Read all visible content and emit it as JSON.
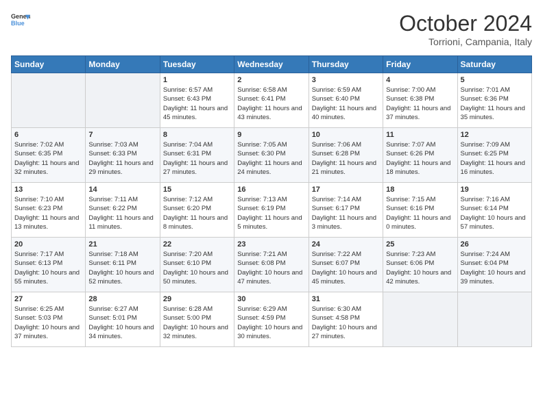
{
  "logo": {
    "line1": "General",
    "line2": "Blue"
  },
  "title": "October 2024",
  "location": "Torrioni, Campania, Italy",
  "days_of_week": [
    "Sunday",
    "Monday",
    "Tuesday",
    "Wednesday",
    "Thursday",
    "Friday",
    "Saturday"
  ],
  "weeks": [
    [
      {
        "num": "",
        "sunrise": "",
        "sunset": "",
        "daylight": ""
      },
      {
        "num": "",
        "sunrise": "",
        "sunset": "",
        "daylight": ""
      },
      {
        "num": "1",
        "sunrise": "Sunrise: 6:57 AM",
        "sunset": "Sunset: 6:43 PM",
        "daylight": "Daylight: 11 hours and 45 minutes."
      },
      {
        "num": "2",
        "sunrise": "Sunrise: 6:58 AM",
        "sunset": "Sunset: 6:41 PM",
        "daylight": "Daylight: 11 hours and 43 minutes."
      },
      {
        "num": "3",
        "sunrise": "Sunrise: 6:59 AM",
        "sunset": "Sunset: 6:40 PM",
        "daylight": "Daylight: 11 hours and 40 minutes."
      },
      {
        "num": "4",
        "sunrise": "Sunrise: 7:00 AM",
        "sunset": "Sunset: 6:38 PM",
        "daylight": "Daylight: 11 hours and 37 minutes."
      },
      {
        "num": "5",
        "sunrise": "Sunrise: 7:01 AM",
        "sunset": "Sunset: 6:36 PM",
        "daylight": "Daylight: 11 hours and 35 minutes."
      }
    ],
    [
      {
        "num": "6",
        "sunrise": "Sunrise: 7:02 AM",
        "sunset": "Sunset: 6:35 PM",
        "daylight": "Daylight: 11 hours and 32 minutes."
      },
      {
        "num": "7",
        "sunrise": "Sunrise: 7:03 AM",
        "sunset": "Sunset: 6:33 PM",
        "daylight": "Daylight: 11 hours and 29 minutes."
      },
      {
        "num": "8",
        "sunrise": "Sunrise: 7:04 AM",
        "sunset": "Sunset: 6:31 PM",
        "daylight": "Daylight: 11 hours and 27 minutes."
      },
      {
        "num": "9",
        "sunrise": "Sunrise: 7:05 AM",
        "sunset": "Sunset: 6:30 PM",
        "daylight": "Daylight: 11 hours and 24 minutes."
      },
      {
        "num": "10",
        "sunrise": "Sunrise: 7:06 AM",
        "sunset": "Sunset: 6:28 PM",
        "daylight": "Daylight: 11 hours and 21 minutes."
      },
      {
        "num": "11",
        "sunrise": "Sunrise: 7:07 AM",
        "sunset": "Sunset: 6:26 PM",
        "daylight": "Daylight: 11 hours and 18 minutes."
      },
      {
        "num": "12",
        "sunrise": "Sunrise: 7:09 AM",
        "sunset": "Sunset: 6:25 PM",
        "daylight": "Daylight: 11 hours and 16 minutes."
      }
    ],
    [
      {
        "num": "13",
        "sunrise": "Sunrise: 7:10 AM",
        "sunset": "Sunset: 6:23 PM",
        "daylight": "Daylight: 11 hours and 13 minutes."
      },
      {
        "num": "14",
        "sunrise": "Sunrise: 7:11 AM",
        "sunset": "Sunset: 6:22 PM",
        "daylight": "Daylight: 11 hours and 11 minutes."
      },
      {
        "num": "15",
        "sunrise": "Sunrise: 7:12 AM",
        "sunset": "Sunset: 6:20 PM",
        "daylight": "Daylight: 11 hours and 8 minutes."
      },
      {
        "num": "16",
        "sunrise": "Sunrise: 7:13 AM",
        "sunset": "Sunset: 6:19 PM",
        "daylight": "Daylight: 11 hours and 5 minutes."
      },
      {
        "num": "17",
        "sunrise": "Sunrise: 7:14 AM",
        "sunset": "Sunset: 6:17 PM",
        "daylight": "Daylight: 11 hours and 3 minutes."
      },
      {
        "num": "18",
        "sunrise": "Sunrise: 7:15 AM",
        "sunset": "Sunset: 6:16 PM",
        "daylight": "Daylight: 11 hours and 0 minutes."
      },
      {
        "num": "19",
        "sunrise": "Sunrise: 7:16 AM",
        "sunset": "Sunset: 6:14 PM",
        "daylight": "Daylight: 10 hours and 57 minutes."
      }
    ],
    [
      {
        "num": "20",
        "sunrise": "Sunrise: 7:17 AM",
        "sunset": "Sunset: 6:13 PM",
        "daylight": "Daylight: 10 hours and 55 minutes."
      },
      {
        "num": "21",
        "sunrise": "Sunrise: 7:18 AM",
        "sunset": "Sunset: 6:11 PM",
        "daylight": "Daylight: 10 hours and 52 minutes."
      },
      {
        "num": "22",
        "sunrise": "Sunrise: 7:20 AM",
        "sunset": "Sunset: 6:10 PM",
        "daylight": "Daylight: 10 hours and 50 minutes."
      },
      {
        "num": "23",
        "sunrise": "Sunrise: 7:21 AM",
        "sunset": "Sunset: 6:08 PM",
        "daylight": "Daylight: 10 hours and 47 minutes."
      },
      {
        "num": "24",
        "sunrise": "Sunrise: 7:22 AM",
        "sunset": "Sunset: 6:07 PM",
        "daylight": "Daylight: 10 hours and 45 minutes."
      },
      {
        "num": "25",
        "sunrise": "Sunrise: 7:23 AM",
        "sunset": "Sunset: 6:06 PM",
        "daylight": "Daylight: 10 hours and 42 minutes."
      },
      {
        "num": "26",
        "sunrise": "Sunrise: 7:24 AM",
        "sunset": "Sunset: 6:04 PM",
        "daylight": "Daylight: 10 hours and 39 minutes."
      }
    ],
    [
      {
        "num": "27",
        "sunrise": "Sunrise: 6:25 AM",
        "sunset": "Sunset: 5:03 PM",
        "daylight": "Daylight: 10 hours and 37 minutes."
      },
      {
        "num": "28",
        "sunrise": "Sunrise: 6:27 AM",
        "sunset": "Sunset: 5:01 PM",
        "daylight": "Daylight: 10 hours and 34 minutes."
      },
      {
        "num": "29",
        "sunrise": "Sunrise: 6:28 AM",
        "sunset": "Sunset: 5:00 PM",
        "daylight": "Daylight: 10 hours and 32 minutes."
      },
      {
        "num": "30",
        "sunrise": "Sunrise: 6:29 AM",
        "sunset": "Sunset: 4:59 PM",
        "daylight": "Daylight: 10 hours and 30 minutes."
      },
      {
        "num": "31",
        "sunrise": "Sunrise: 6:30 AM",
        "sunset": "Sunset: 4:58 PM",
        "daylight": "Daylight: 10 hours and 27 minutes."
      },
      {
        "num": "",
        "sunrise": "",
        "sunset": "",
        "daylight": ""
      },
      {
        "num": "",
        "sunrise": "",
        "sunset": "",
        "daylight": ""
      }
    ]
  ]
}
